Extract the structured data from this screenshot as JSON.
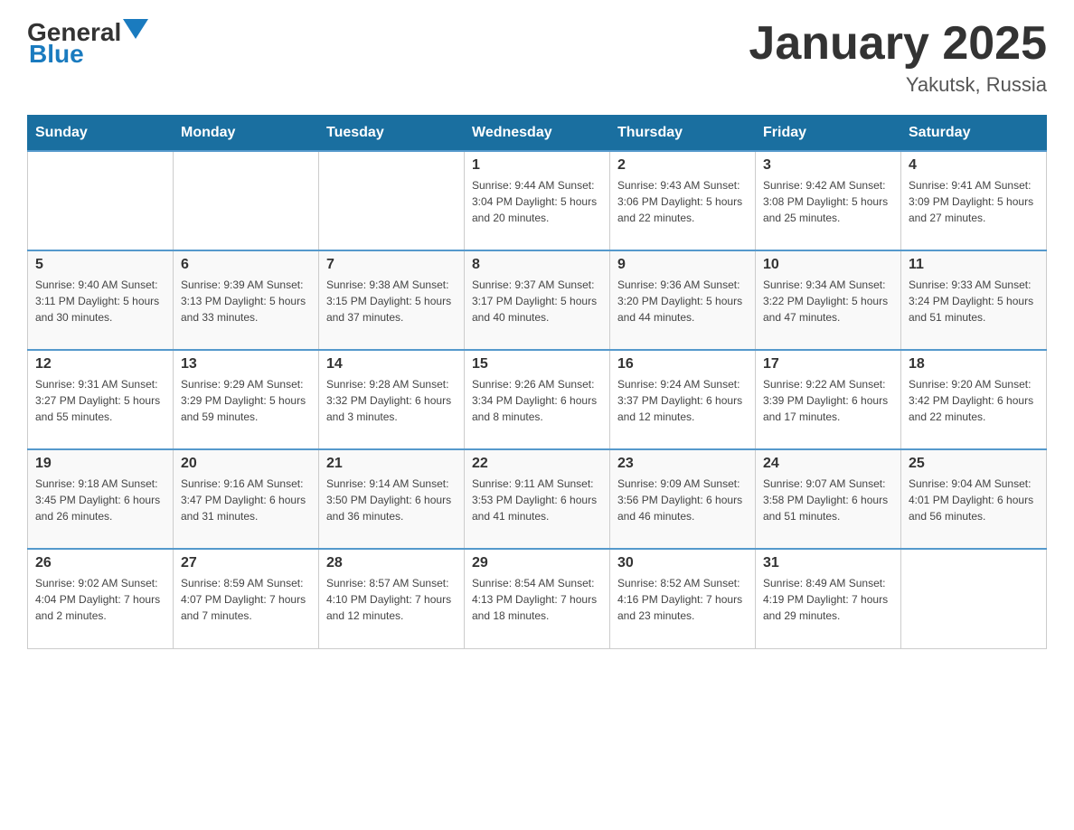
{
  "header": {
    "logo": {
      "text_general": "General",
      "text_blue": "Blue",
      "alt": "GeneralBlue logo"
    },
    "title": "January 2025",
    "subtitle": "Yakutsk, Russia"
  },
  "calendar": {
    "days_of_week": [
      "Sunday",
      "Monday",
      "Tuesday",
      "Wednesday",
      "Thursday",
      "Friday",
      "Saturday"
    ],
    "weeks": [
      [
        {
          "day": "",
          "info": ""
        },
        {
          "day": "",
          "info": ""
        },
        {
          "day": "",
          "info": ""
        },
        {
          "day": "1",
          "info": "Sunrise: 9:44 AM\nSunset: 3:04 PM\nDaylight: 5 hours\nand 20 minutes."
        },
        {
          "day": "2",
          "info": "Sunrise: 9:43 AM\nSunset: 3:06 PM\nDaylight: 5 hours\nand 22 minutes."
        },
        {
          "day": "3",
          "info": "Sunrise: 9:42 AM\nSunset: 3:08 PM\nDaylight: 5 hours\nand 25 minutes."
        },
        {
          "day": "4",
          "info": "Sunrise: 9:41 AM\nSunset: 3:09 PM\nDaylight: 5 hours\nand 27 minutes."
        }
      ],
      [
        {
          "day": "5",
          "info": "Sunrise: 9:40 AM\nSunset: 3:11 PM\nDaylight: 5 hours\nand 30 minutes."
        },
        {
          "day": "6",
          "info": "Sunrise: 9:39 AM\nSunset: 3:13 PM\nDaylight: 5 hours\nand 33 minutes."
        },
        {
          "day": "7",
          "info": "Sunrise: 9:38 AM\nSunset: 3:15 PM\nDaylight: 5 hours\nand 37 minutes."
        },
        {
          "day": "8",
          "info": "Sunrise: 9:37 AM\nSunset: 3:17 PM\nDaylight: 5 hours\nand 40 minutes."
        },
        {
          "day": "9",
          "info": "Sunrise: 9:36 AM\nSunset: 3:20 PM\nDaylight: 5 hours\nand 44 minutes."
        },
        {
          "day": "10",
          "info": "Sunrise: 9:34 AM\nSunset: 3:22 PM\nDaylight: 5 hours\nand 47 minutes."
        },
        {
          "day": "11",
          "info": "Sunrise: 9:33 AM\nSunset: 3:24 PM\nDaylight: 5 hours\nand 51 minutes."
        }
      ],
      [
        {
          "day": "12",
          "info": "Sunrise: 9:31 AM\nSunset: 3:27 PM\nDaylight: 5 hours\nand 55 minutes."
        },
        {
          "day": "13",
          "info": "Sunrise: 9:29 AM\nSunset: 3:29 PM\nDaylight: 5 hours\nand 59 minutes."
        },
        {
          "day": "14",
          "info": "Sunrise: 9:28 AM\nSunset: 3:32 PM\nDaylight: 6 hours\nand 3 minutes."
        },
        {
          "day": "15",
          "info": "Sunrise: 9:26 AM\nSunset: 3:34 PM\nDaylight: 6 hours\nand 8 minutes."
        },
        {
          "day": "16",
          "info": "Sunrise: 9:24 AM\nSunset: 3:37 PM\nDaylight: 6 hours\nand 12 minutes."
        },
        {
          "day": "17",
          "info": "Sunrise: 9:22 AM\nSunset: 3:39 PM\nDaylight: 6 hours\nand 17 minutes."
        },
        {
          "day": "18",
          "info": "Sunrise: 9:20 AM\nSunset: 3:42 PM\nDaylight: 6 hours\nand 22 minutes."
        }
      ],
      [
        {
          "day": "19",
          "info": "Sunrise: 9:18 AM\nSunset: 3:45 PM\nDaylight: 6 hours\nand 26 minutes."
        },
        {
          "day": "20",
          "info": "Sunrise: 9:16 AM\nSunset: 3:47 PM\nDaylight: 6 hours\nand 31 minutes."
        },
        {
          "day": "21",
          "info": "Sunrise: 9:14 AM\nSunset: 3:50 PM\nDaylight: 6 hours\nand 36 minutes."
        },
        {
          "day": "22",
          "info": "Sunrise: 9:11 AM\nSunset: 3:53 PM\nDaylight: 6 hours\nand 41 minutes."
        },
        {
          "day": "23",
          "info": "Sunrise: 9:09 AM\nSunset: 3:56 PM\nDaylight: 6 hours\nand 46 minutes."
        },
        {
          "day": "24",
          "info": "Sunrise: 9:07 AM\nSunset: 3:58 PM\nDaylight: 6 hours\nand 51 minutes."
        },
        {
          "day": "25",
          "info": "Sunrise: 9:04 AM\nSunset: 4:01 PM\nDaylight: 6 hours\nand 56 minutes."
        }
      ],
      [
        {
          "day": "26",
          "info": "Sunrise: 9:02 AM\nSunset: 4:04 PM\nDaylight: 7 hours\nand 2 minutes."
        },
        {
          "day": "27",
          "info": "Sunrise: 8:59 AM\nSunset: 4:07 PM\nDaylight: 7 hours\nand 7 minutes."
        },
        {
          "day": "28",
          "info": "Sunrise: 8:57 AM\nSunset: 4:10 PM\nDaylight: 7 hours\nand 12 minutes."
        },
        {
          "day": "29",
          "info": "Sunrise: 8:54 AM\nSunset: 4:13 PM\nDaylight: 7 hours\nand 18 minutes."
        },
        {
          "day": "30",
          "info": "Sunrise: 8:52 AM\nSunset: 4:16 PM\nDaylight: 7 hours\nand 23 minutes."
        },
        {
          "day": "31",
          "info": "Sunrise: 8:49 AM\nSunset: 4:19 PM\nDaylight: 7 hours\nand 29 minutes."
        },
        {
          "day": "",
          "info": ""
        }
      ]
    ]
  }
}
